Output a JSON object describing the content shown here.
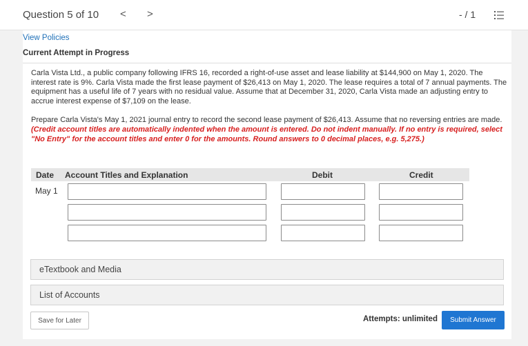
{
  "header": {
    "question_label": "Question 5 of 10",
    "prev_glyph": "<",
    "next_glyph": ">",
    "score": "- / 1"
  },
  "links": {
    "view_policies": "View Policies"
  },
  "status": {
    "current_attempt": "Current Attempt in Progress"
  },
  "question": {
    "paragraph1": "Carla Vista Ltd., a public company following IFRS 16, recorded a right-of-use asset and lease liability at $144,900 on May 1, 2020. The interest rate is 9%. Carla Vista made the first lease payment of $26,413 on May 1, 2020. The lease requires a total of 7 annual payments. The equipment has a useful life of 7 years with no residual value. Assume that at December 31, 2020, Carla Vista made an adjusting entry to accrue interest expense of $7,109 on the lease.",
    "paragraph2": "Prepare Carla Vista's May 1, 2021 journal entry to record the second lease payment of $26,413. Assume that no reversing entries are made.",
    "instructions": "(Credit account titles are automatically indented when the amount is entered. Do not indent manually. If no entry is required, select \"No Entry\" for the account titles and enter 0 for the amounts. Round answers to 0 decimal places, e.g. 5,275.)"
  },
  "journal_table": {
    "headers": {
      "date": "Date",
      "account": "Account Titles and Explanation",
      "debit": "Debit",
      "credit": "Credit"
    },
    "date_value": "May 1",
    "rows": [
      {
        "account": "",
        "debit": "",
        "credit": ""
      },
      {
        "account": "",
        "debit": "",
        "credit": ""
      },
      {
        "account": "",
        "debit": "",
        "credit": ""
      }
    ]
  },
  "resources": {
    "etextbook": "eTextbook and Media",
    "list_of_accounts": "List of Accounts"
  },
  "footer": {
    "save_label": "Save for Later",
    "attempts_label": "Attempts: unlimited",
    "submit_label": "Submit Answer"
  },
  "colors": {
    "link": "#1f70b8",
    "instruction_red": "#d71f1f",
    "submit_blue": "#1f76d2"
  }
}
